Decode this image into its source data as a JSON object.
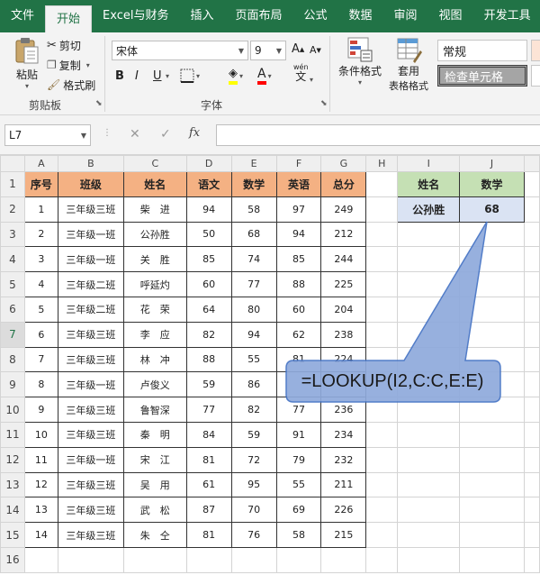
{
  "menu_tabs": [
    "文件",
    "开始",
    "Excel与财务",
    "插入",
    "页面布局",
    "公式",
    "数据",
    "审阅",
    "视图",
    "开发工具"
  ],
  "ribbon": {
    "clipboard": {
      "paste": "粘贴",
      "cut": "剪切",
      "copy": "复制",
      "format_painter": "格式刷",
      "label": "剪贴板"
    },
    "font": {
      "name": "宋体",
      "size": "9",
      "label": "字体",
      "bold": "B",
      "italic": "I",
      "underline": "U",
      "wen": "wén"
    },
    "styles": {
      "conditional": "条件格式",
      "table_1": "套用",
      "table_2": "表格格式",
      "normal": "常规",
      "check_cell": "检查单元格"
    }
  },
  "formula_bar": {
    "name_box": "L7",
    "cancel": "✕",
    "enter": "✓",
    "fx": "fx",
    "formula": ""
  },
  "grid": {
    "columns": [
      "A",
      "B",
      "C",
      "D",
      "E",
      "F",
      "G",
      "H",
      "I",
      "J"
    ],
    "rows": [
      "1",
      "2",
      "3",
      "4",
      "5",
      "6",
      "7",
      "8",
      "9",
      "10",
      "11",
      "12",
      "13",
      "14",
      "15",
      "16"
    ],
    "selected_row": "7",
    "data_headers": [
      "序号",
      "班级",
      "姓名",
      "语文",
      "数学",
      "英语",
      "总分"
    ],
    "data": [
      [
        "1",
        "三年级三班",
        "柴　进",
        "94",
        "58",
        "97",
        "249"
      ],
      [
        "2",
        "三年级一班",
        "公孙胜",
        "50",
        "68",
        "94",
        "212"
      ],
      [
        "3",
        "三年级一班",
        "关　胜",
        "85",
        "74",
        "85",
        "244"
      ],
      [
        "4",
        "三年级二班",
        "呼延灼",
        "60",
        "77",
        "88",
        "225"
      ],
      [
        "5",
        "三年级二班",
        "花　荣",
        "64",
        "80",
        "60",
        "204"
      ],
      [
        "6",
        "三年级三班",
        "李　应",
        "82",
        "94",
        "62",
        "238"
      ],
      [
        "7",
        "三年级三班",
        "林　冲",
        "88",
        "55",
        "81",
        "224"
      ],
      [
        "8",
        "三年级一班",
        "卢俊义",
        "59",
        "86",
        "",
        ""
      ],
      [
        "9",
        "三年级三班",
        "鲁智深",
        "77",
        "82",
        "77",
        "236"
      ],
      [
        "10",
        "三年级三班",
        "秦　明",
        "84",
        "59",
        "91",
        "234"
      ],
      [
        "11",
        "三年级一班",
        "宋　江",
        "81",
        "72",
        "79",
        "232"
      ],
      [
        "12",
        "三年级三班",
        "吴　用",
        "61",
        "95",
        "55",
        "211"
      ],
      [
        "13",
        "三年级三班",
        "武　松",
        "87",
        "70",
        "69",
        "226"
      ],
      [
        "14",
        "三年级三班",
        "朱　仝",
        "81",
        "76",
        "58",
        "215"
      ]
    ],
    "lookup_headers": [
      "姓名",
      "数学"
    ],
    "lookup_values": [
      "公孙胜",
      "68"
    ]
  },
  "callout": {
    "text": "=LOOKUP(I2,C:C,E:E)"
  },
  "colors": {
    "excel_green": "#217346",
    "header_orange": "#f4b183",
    "lookup_green": "#c5e0b4",
    "lookup_blue": "#dae3f3",
    "callout_fill": "#8faadc",
    "callout_border": "#4472c4"
  }
}
